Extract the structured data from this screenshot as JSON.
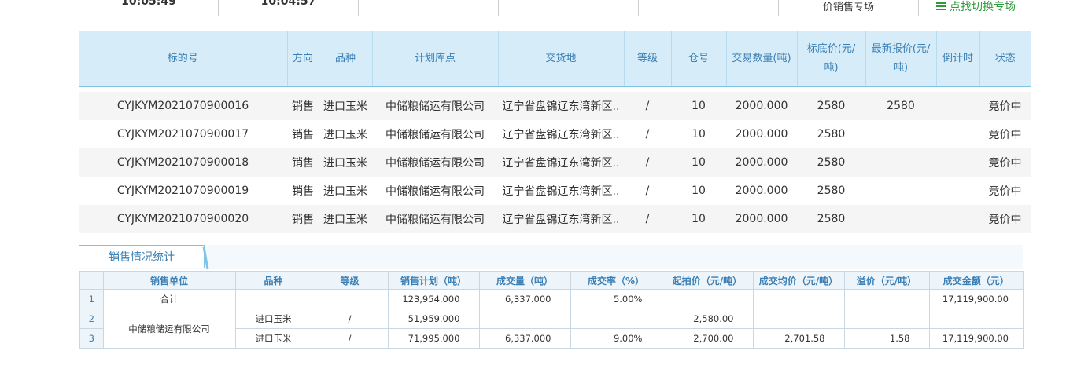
{
  "top_strip": {
    "cells": [
      "10:05:49",
      "10:04:57",
      "",
      "",
      "",
      "价销售专场"
    ],
    "partial_red": ""
  },
  "switch_link": {
    "label": "点找切换专场",
    "icon": "list-icon"
  },
  "main_table": {
    "headers": {
      "code": "标的号",
      "direction": "方向",
      "variety": "品种",
      "warehouse": "计划库点",
      "delivery": "交货地",
      "grade": "等级",
      "bin": "仓号",
      "qty": "交易数量(吨)",
      "base_price_l1": "标底价(元/",
      "base_price_l2": "吨)",
      "latest_l1": "最新报价(元/",
      "latest_l2": "吨)",
      "countdown": "倒计时",
      "status": "状态"
    },
    "rows": [
      {
        "code": "CYJKYM2021070900016",
        "direction": "销售",
        "variety": "进口玉米",
        "warehouse": "中储粮储运有限公司",
        "delivery": "辽宁省盘锦辽东湾新区..",
        "grade": "/",
        "bin": "10",
        "qty": "2000.000",
        "base": "2580",
        "latest": "2580",
        "countdown": "",
        "status": "竞价中"
      },
      {
        "code": "CYJKYM2021070900017",
        "direction": "销售",
        "variety": "进口玉米",
        "warehouse": "中储粮储运有限公司",
        "delivery": "辽宁省盘锦辽东湾新区..",
        "grade": "/",
        "bin": "10",
        "qty": "2000.000",
        "base": "2580",
        "latest": "",
        "countdown": "",
        "status": "竞价中"
      },
      {
        "code": "CYJKYM2021070900018",
        "direction": "销售",
        "variety": "进口玉米",
        "warehouse": "中储粮储运有限公司",
        "delivery": "辽宁省盘锦辽东湾新区..",
        "grade": "/",
        "bin": "10",
        "qty": "2000.000",
        "base": "2580",
        "latest": "",
        "countdown": "",
        "status": "竞价中"
      },
      {
        "code": "CYJKYM2021070900019",
        "direction": "销售",
        "variety": "进口玉米",
        "warehouse": "中储粮储运有限公司",
        "delivery": "辽宁省盘锦辽东湾新区..",
        "grade": "/",
        "bin": "10",
        "qty": "2000.000",
        "base": "2580",
        "latest": "",
        "countdown": "",
        "status": "竞价中"
      },
      {
        "code": "CYJKYM2021070900020",
        "direction": "销售",
        "variety": "进口玉米",
        "warehouse": "中储粮储运有限公司",
        "delivery": "辽宁省盘锦辽东湾新区..",
        "grade": "/",
        "bin": "10",
        "qty": "2000.000",
        "base": "2580",
        "latest": "",
        "countdown": "",
        "status": "竞价中"
      }
    ]
  },
  "stats": {
    "tab_label": "销售情况统计",
    "headers": [
      "",
      "销售单位",
      "品种",
      "等级",
      "销售计划（吨）",
      "成交量（吨）",
      "成交率（%）",
      "起拍价（元/吨）",
      "成交均价（元/吨）",
      "溢价（元/吨）",
      "成交金额（元）"
    ],
    "total": {
      "idx": "1",
      "unit": "合计",
      "variety": "",
      "grade": "",
      "plan": "123,954.000",
      "volume": "6,337.000",
      "rate": "5.00%",
      "start": "",
      "avg": "",
      "premium": "",
      "amount": "17,119,900.00"
    },
    "unit_name": "中储粮储运有限公司",
    "rows": [
      {
        "idx": "2",
        "variety": "进口玉米",
        "grade": "/",
        "plan": "51,959.000",
        "volume": "",
        "rate": "",
        "start": "2,580.00",
        "avg": "",
        "premium": "",
        "amount": ""
      },
      {
        "idx": "3",
        "variety": "进口玉米",
        "grade": "/",
        "plan": "71,995.000",
        "volume": "6,337.000",
        "rate": "9.00%",
        "start": "2,700.00",
        "avg": "2,701.58",
        "premium": "1.58",
        "amount": "17,119,900.00"
      }
    ]
  }
}
